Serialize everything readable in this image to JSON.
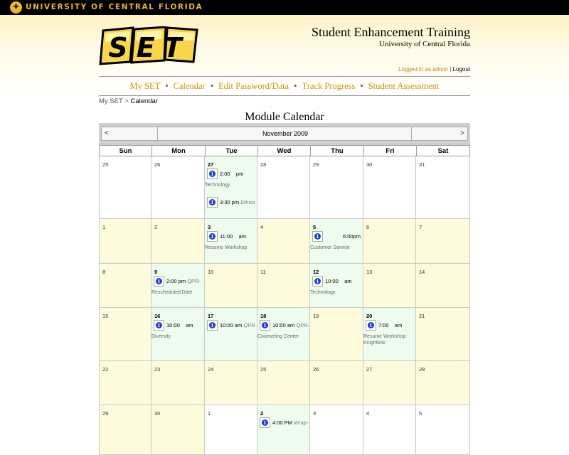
{
  "university": {
    "name": "UNIVERSITY OF CENTRAL FLORIDA"
  },
  "header": {
    "logo_text": "SET",
    "title": "Student Enhancement Training",
    "subtitle": "University of Central Florida",
    "login_prefix": "Logged in as",
    "login_user": "admin",
    "login_sep": "|",
    "logout": "Logout"
  },
  "nav": [
    "My SET",
    "Calendar",
    "Edit Password/Data",
    "Track Progress",
    "Student Assessment"
  ],
  "breadcrumb": {
    "home": "My SET",
    "sep": ">",
    "current": "Calendar"
  },
  "calendar": {
    "title": "Module Calendar",
    "prev": "<",
    "month": "November 2009",
    "next": ">",
    "days_of_week": [
      "Sun",
      "Mon",
      "Tue",
      "Wed",
      "Thu",
      "Fri",
      "Sat"
    ],
    "info_icon": "i",
    "colors": {
      "header_bg": "#fff2c7",
      "current_month_bg": "#fdfbdb",
      "event_day_bg": "#eefcee",
      "accent": "#c8960f",
      "info_icon": "#1b3fd1"
    },
    "weeks": [
      [
        {
          "day": "25",
          "bg": "white"
        },
        {
          "day": "26",
          "bg": "white"
        },
        {
          "day": "27",
          "bg": "green",
          "bold": true,
          "events": [
            {
              "time": "2:00    pm",
              "title": "Technology"
            },
            {
              "time": "3:30 pm",
              "after": "Ethics",
              "title": ""
            }
          ]
        },
        {
          "day": "28",
          "bg": "white"
        },
        {
          "day": "29",
          "bg": "white"
        },
        {
          "day": "30",
          "bg": "white"
        },
        {
          "day": "31",
          "bg": "white"
        }
      ],
      [
        {
          "day": "1",
          "bg": "yellow"
        },
        {
          "day": "2",
          "bg": "yellow"
        },
        {
          "day": "3",
          "bg": "green",
          "bold": true,
          "events": [
            {
              "time": "11:00    am",
              "title": "Resume Workshop"
            }
          ]
        },
        {
          "day": "4",
          "bg": "yellow"
        },
        {
          "day": "5",
          "bg": "green",
          "bold": true,
          "events": [
            {
              "time": "            6:00pm",
              "title": "Customer Service"
            }
          ]
        },
        {
          "day": "6",
          "bg": "yellow"
        },
        {
          "day": "7",
          "bg": "yellow"
        }
      ],
      [
        {
          "day": "8",
          "bg": "yellow"
        },
        {
          "day": "9",
          "bg": "green",
          "bold": true,
          "events": [
            {
              "time": "2:00 pm",
              "after": "QPR-",
              "title": "Rescheduled Date"
            }
          ]
        },
        {
          "day": "10",
          "bg": "yellow"
        },
        {
          "day": "11",
          "bg": "yellow"
        },
        {
          "day": "12",
          "bg": "green",
          "bold": true,
          "events": [
            {
              "time": "10:00    am",
              "title": "Technology"
            }
          ]
        },
        {
          "day": "13",
          "bg": "yellow"
        },
        {
          "day": "14",
          "bg": "yellow"
        }
      ],
      [
        {
          "day": "15",
          "bg": "yellow"
        },
        {
          "day": "16",
          "bg": "green",
          "bold": true,
          "events": [
            {
              "time": "10:00    am",
              "title": "Diversity"
            }
          ]
        },
        {
          "day": "17",
          "bg": "green",
          "bold": true,
          "events": [
            {
              "time": "10:00 am",
              "after": "QPR",
              "title": ""
            }
          ]
        },
        {
          "day": "18",
          "bg": "green",
          "bold": true,
          "events": [
            {
              "time": "10:00 am",
              "after": "QPR-",
              "title": "Counseling Center"
            }
          ]
        },
        {
          "day": "19",
          "bg": "yellow"
        },
        {
          "day": "20",
          "bg": "green",
          "bold": true,
          "events": [
            {
              "time": "7:00    am",
              "title": "Resume Workshop -",
              "title2": "Knightlink"
            }
          ]
        },
        {
          "day": "21",
          "bg": "yellow"
        }
      ],
      [
        {
          "day": "22",
          "bg": "yellow"
        },
        {
          "day": "23",
          "bg": "yellow"
        },
        {
          "day": "24",
          "bg": "yellow"
        },
        {
          "day": "25",
          "bg": "yellow"
        },
        {
          "day": "26",
          "bg": "yellow"
        },
        {
          "day": "27",
          "bg": "yellow"
        },
        {
          "day": "28",
          "bg": "yellow"
        }
      ],
      [
        {
          "day": "29",
          "bg": "yellow"
        },
        {
          "day": "30",
          "bg": "yellow"
        },
        {
          "day": "1",
          "bg": "white"
        },
        {
          "day": "2",
          "bg": "green",
          "bold": true,
          "events": [
            {
              "time": "4:00 PM",
              "after": "Wrap-",
              "title": ""
            }
          ]
        },
        {
          "day": "3",
          "bg": "white"
        },
        {
          "day": "4",
          "bg": "white"
        },
        {
          "day": "5",
          "bg": "white"
        }
      ]
    ]
  }
}
